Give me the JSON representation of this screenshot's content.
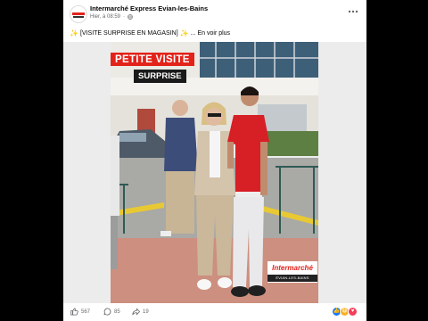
{
  "post": {
    "page_name": "Intermarché Express Evian-les-Bains",
    "timestamp": "Hier, à 08:59",
    "separator": "·",
    "text": "[VISITE SURPRISE EN MAGASIN]",
    "ellipsis": "...",
    "see_more": "En voir plus",
    "more_icon": "more-options-icon"
  },
  "photo": {
    "banner_line1": "PETITE VISITE",
    "banner_line2": "SURPRISE",
    "logo_text": "Intermarché",
    "logo_sub": "ÉVIAN-LES-BAINS"
  },
  "stats": {
    "likes": "567",
    "comments": "85",
    "shares": "19"
  },
  "colors": {
    "brand_red": "#e2231a",
    "like_blue": "#1877f2",
    "love_red": "#f33e58",
    "haha_yellow": "#f7b125"
  }
}
